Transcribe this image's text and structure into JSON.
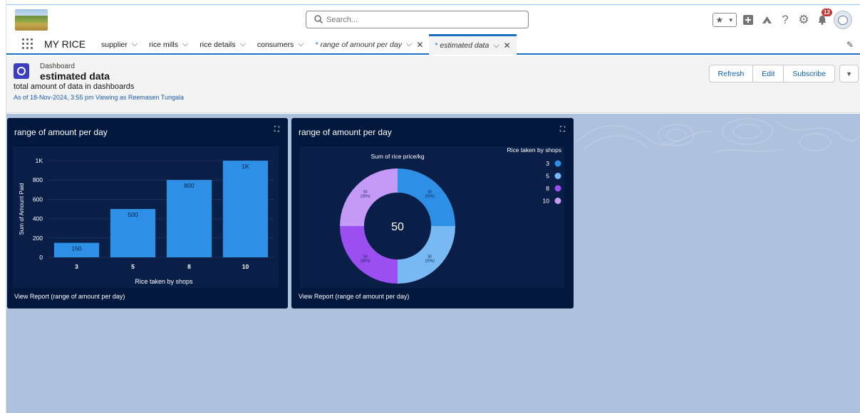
{
  "header": {
    "search_placeholder": "Search...",
    "notification_count": "12"
  },
  "nav": {
    "app_name": "MY RICE",
    "tabs": [
      {
        "label": "supplier"
      },
      {
        "label": "rice mills"
      },
      {
        "label": "rice details"
      },
      {
        "label": "consumers"
      },
      {
        "label": "range of amount per day"
      },
      {
        "label": "estimated data"
      }
    ]
  },
  "dashboard": {
    "type_label": "Dashboard",
    "title": "estimated data",
    "description": "total amount of data in dashboards",
    "as_of": "As of 18-Nov-2024, 3:55 pm Viewing as Reemasen Tungala",
    "buttons": {
      "refresh": "Refresh",
      "edit": "Edit",
      "subscribe": "Subscribe"
    }
  },
  "widgets": [
    {
      "title": "range of amount per day",
      "link": "View Report (range of amount per day)"
    },
    {
      "title": "range of amount per day",
      "link": "View Report (range of amount per day)"
    }
  ],
  "chart_data": [
    {
      "type": "bar",
      "categories": [
        "3",
        "5",
        "8",
        "10"
      ],
      "values": [
        150,
        500,
        800,
        1000
      ],
      "data_labels": [
        "150",
        "500",
        "800",
        "1K"
      ],
      "xlabel": "Rice taken by shops",
      "ylabel": "Sum of Amount Paid",
      "yticks": [
        "0",
        "200",
        "400",
        "600",
        "800",
        "1K"
      ],
      "ylim": [
        0,
        1000
      ],
      "color": "#2e8fe6",
      "grid": true
    },
    {
      "type": "pie",
      "donut": true,
      "title": "Sum of rice price/kg",
      "center_label": "50",
      "legend_title": "Rice taken by shops",
      "legend_position": "top-right",
      "categories": [
        "3",
        "5",
        "8",
        "10"
      ],
      "values": [
        50,
        50,
        50,
        50
      ],
      "slice_labels": [
        "50\n(25%)",
        "50\n(25%)",
        "50\n(25%)",
        "50\n(25%)"
      ],
      "colors": [
        "#2e8fe6",
        "#78b9f3",
        "#9b4ff0",
        "#c59af6"
      ]
    }
  ]
}
